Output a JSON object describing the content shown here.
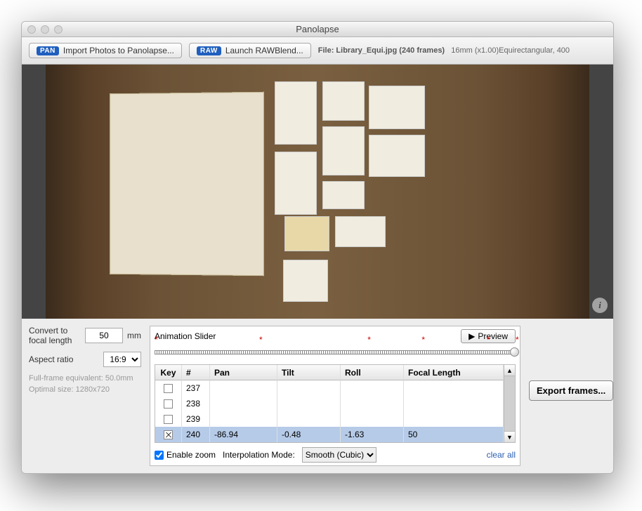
{
  "window": {
    "title": "Panolapse"
  },
  "toolbar": {
    "badge_pan": "PAN",
    "import_label": "Import Photos to Panolapse...",
    "badge_raw": "RAW",
    "rawblend_label": "Launch RAWBlend...",
    "file_label": "File: Library_Equi.jpg (240 frames)",
    "meta": "16mm (x1.00)Equirectangular, 400"
  },
  "left": {
    "convert_label": "Convert to focal length",
    "focal_value": "50",
    "mm": "mm",
    "aspect_label": "Aspect ratio",
    "aspect_value": "16:9",
    "hint1": "Full-frame equivalent: 50.0mm",
    "hint2": "Optimal size: 1280x720"
  },
  "slider": {
    "title": "Animation Slider",
    "preview": "Preview",
    "marks": [
      0,
      29,
      59,
      74,
      92,
      100
    ]
  },
  "grid": {
    "headers": {
      "key": "Key",
      "num": "#",
      "pan": "Pan",
      "tilt": "Tilt",
      "roll": "Roll",
      "fl": "Focal Length"
    },
    "rows": [
      {
        "key": false,
        "num": "237",
        "pan": "",
        "tilt": "",
        "roll": "",
        "fl": ""
      },
      {
        "key": false,
        "num": "238",
        "pan": "",
        "tilt": "",
        "roll": "",
        "fl": ""
      },
      {
        "key": false,
        "num": "239",
        "pan": "",
        "tilt": "",
        "roll": "",
        "fl": ""
      },
      {
        "key": true,
        "num": "240",
        "pan": "-86.94",
        "tilt": "-0.48",
        "roll": "-1.63",
        "fl": "50",
        "selected": true
      }
    ]
  },
  "bottom": {
    "enable_zoom": "Enable zoom",
    "enable_zoom_checked": true,
    "interp_label": "Interpolation Mode:",
    "interp_value": "Smooth (Cubic)",
    "clear_all": "clear all"
  },
  "export": {
    "label": "Export frames..."
  }
}
